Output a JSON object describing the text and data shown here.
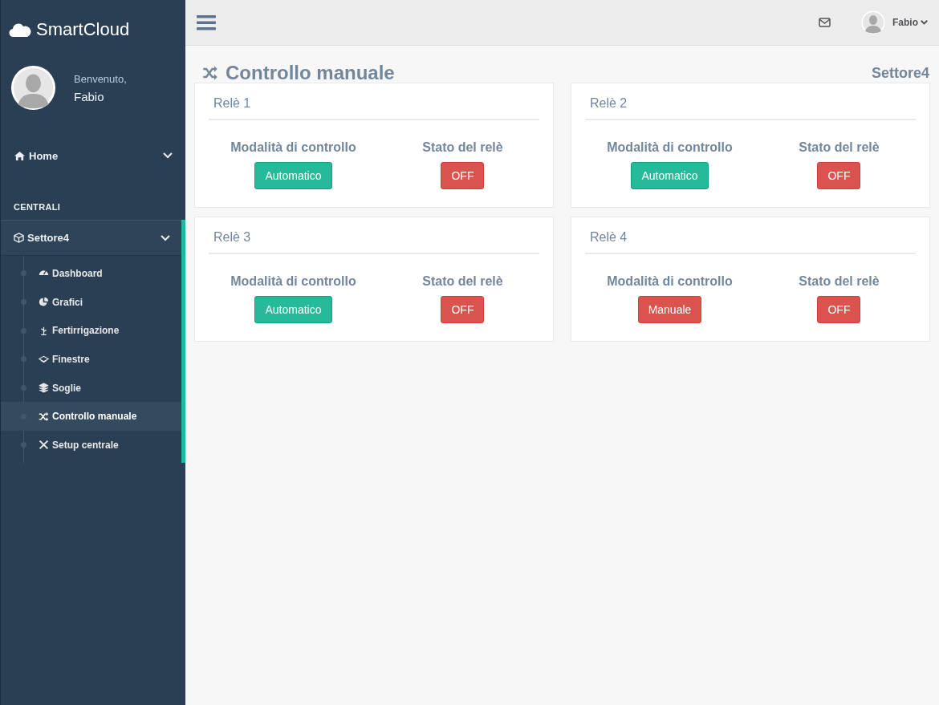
{
  "brand": {
    "title": "SmartCloud"
  },
  "profile": {
    "greeting": "Benvenuto,",
    "name": "Fabio"
  },
  "sidebar": {
    "home": {
      "label": "Home",
      "expanded": false
    },
    "section_title": "CENTRALI",
    "group": {
      "label": "Settore4",
      "expanded": true,
      "items": [
        {
          "label": "Dashboard",
          "selected": false
        },
        {
          "label": "Grafici",
          "selected": false
        },
        {
          "label": "Fertirrigazione",
          "selected": false
        },
        {
          "label": "Finestre",
          "selected": false
        },
        {
          "label": "Soglie",
          "selected": false
        },
        {
          "label": "Controllo manuale",
          "selected": true
        },
        {
          "label": "Setup centrale",
          "selected": false
        }
      ]
    }
  },
  "topbar": {
    "user": "Fabio"
  },
  "page": {
    "title": "Controllo manuale",
    "sector": "Settore4"
  },
  "relays": [
    {
      "title": "Relè 1",
      "mode_label": "Modalità di controllo",
      "mode": {
        "label": "Automatico",
        "kind": "auto"
      },
      "state_label": "Stato del relè",
      "state": {
        "label": "OFF",
        "on": false
      }
    },
    {
      "title": "Relè 2",
      "mode_label": "Modalità di controllo",
      "mode": {
        "label": "Automatico",
        "kind": "auto"
      },
      "state_label": "Stato del relè",
      "state": {
        "label": "OFF",
        "on": false
      }
    },
    {
      "title": "Relè 3",
      "mode_label": "Modalità di controllo",
      "mode": {
        "label": "Automatico",
        "kind": "auto"
      },
      "state_label": "Stato del relè",
      "state": {
        "label": "OFF",
        "on": false
      }
    },
    {
      "title": "Relè 4",
      "mode_label": "Modalità di controllo",
      "mode": {
        "label": "Manuale",
        "kind": "manual"
      },
      "state_label": "Stato del relè",
      "state": {
        "label": "OFF",
        "on": false
      }
    }
  ]
}
